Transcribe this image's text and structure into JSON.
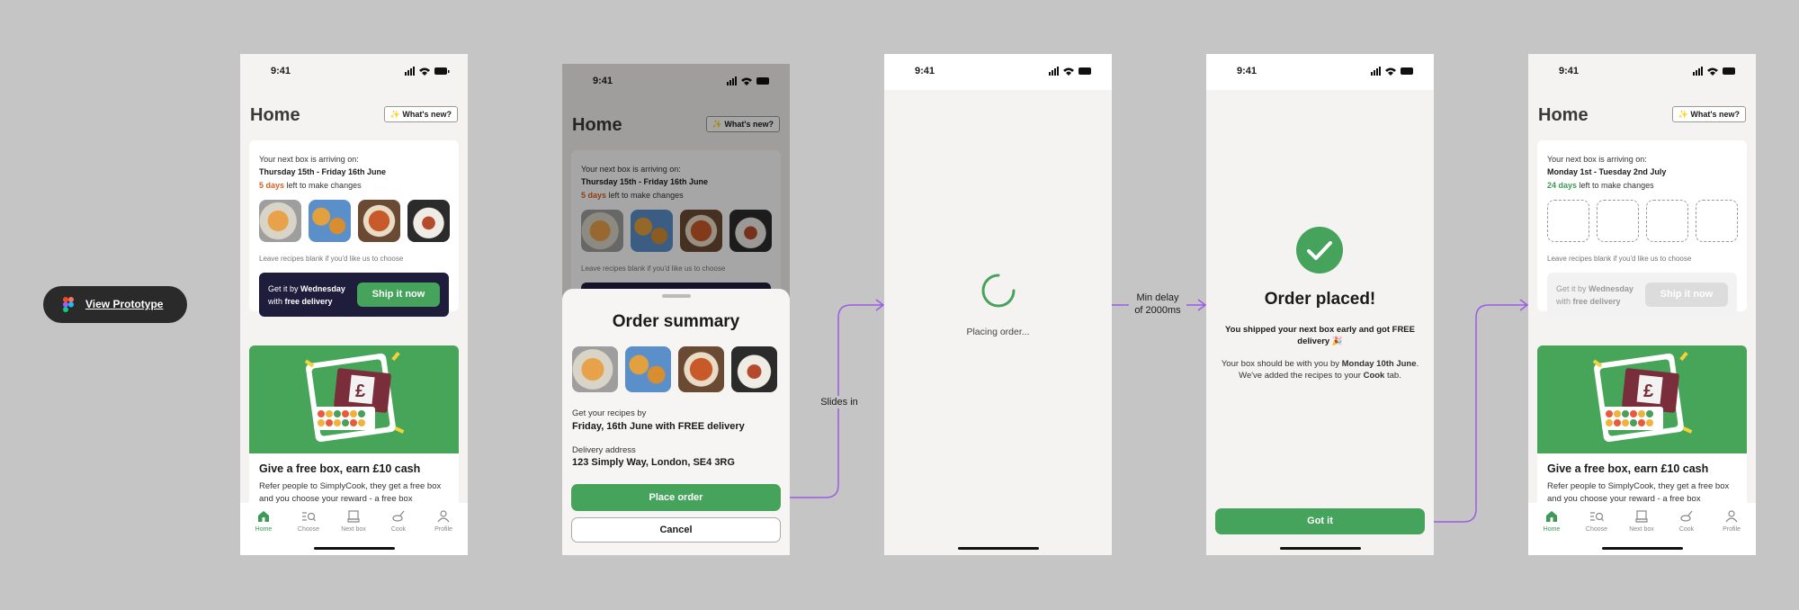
{
  "prototype": {
    "label": "View Prototype"
  },
  "status": {
    "time": "9:41"
  },
  "screen1": {
    "title": "Home",
    "whats_new": "✨ What's new?",
    "card": {
      "arriving_label": "Your next box is arriving on:",
      "dates": "Thursday 15th - Friday 16th June",
      "days": "5 days",
      "left_text": " left to make changes",
      "hint": "Leave recipes blank if you'd like us to choose",
      "ship_line1_a": "Get it by ",
      "ship_line1_b": "Wednesday",
      "ship_line2_a": "with ",
      "ship_line2_b": "free delivery",
      "ship_button": "Ship it now"
    },
    "promo": {
      "title": "Give a free box, earn £10 cash",
      "body": "Refer people to SimplyCook, they get a free box and you choose your reward - a free box"
    }
  },
  "tabs": [
    {
      "label": "Home",
      "icon": "home-icon"
    },
    {
      "label": "Choose",
      "icon": "choose-icon"
    },
    {
      "label": "Next box",
      "icon": "box-icon"
    },
    {
      "label": "Cook",
      "icon": "pan-icon"
    },
    {
      "label": "Profile",
      "icon": "profile-icon"
    }
  ],
  "screen2": {
    "title": "Order summary",
    "recipes_label": "Get your recipes by",
    "recipes_value": "Friday, 16th June with FREE delivery",
    "address_label": "Delivery address",
    "address_value": "123 Simply Way, London, SE4 3RG",
    "place_order": "Place order",
    "cancel": "Cancel"
  },
  "screen3": {
    "loading_text": "Placing order..."
  },
  "screen4": {
    "title": "Order placed!",
    "msg1": "You shipped your next box early and got FREE delivery 🎉",
    "msg2_a": "Your box should be with you by ",
    "msg2_b": "Monday 10th June",
    "msg2_c": ". We've added the recipes to your ",
    "msg2_d": "Cook",
    "msg2_e": " tab.",
    "got_it": "Got it"
  },
  "screen5": {
    "title": "Home",
    "whats_new": "✨ What's new?",
    "card": {
      "arriving_label": "Your next box is arriving on:",
      "dates": "Monday 1st - Tuesday 2nd July",
      "days": "24 days",
      "left_text": " left to make changes",
      "hint": "Leave recipes blank if you'd like us to choose",
      "ship_line1_a": "Get it by ",
      "ship_line1_b": "Wednesday",
      "ship_line2_a": "with ",
      "ship_line2_b": "free delivery",
      "ship_button": "Ship it now"
    },
    "promo": {
      "title": "Give a free box, earn £10 cash",
      "body": "Refer people to SimplyCook, they get a free box and you choose your reward - a free box"
    }
  },
  "flow": {
    "slides_in": "Slides in",
    "min_delay_1": "Min delay",
    "min_delay_2": "of 2000ms"
  },
  "colors": {
    "brand_green": "#45a35c",
    "navy": "#1e1d3c",
    "flow_purple": "#9b5de5",
    "warning_orange": "#d8601f"
  }
}
